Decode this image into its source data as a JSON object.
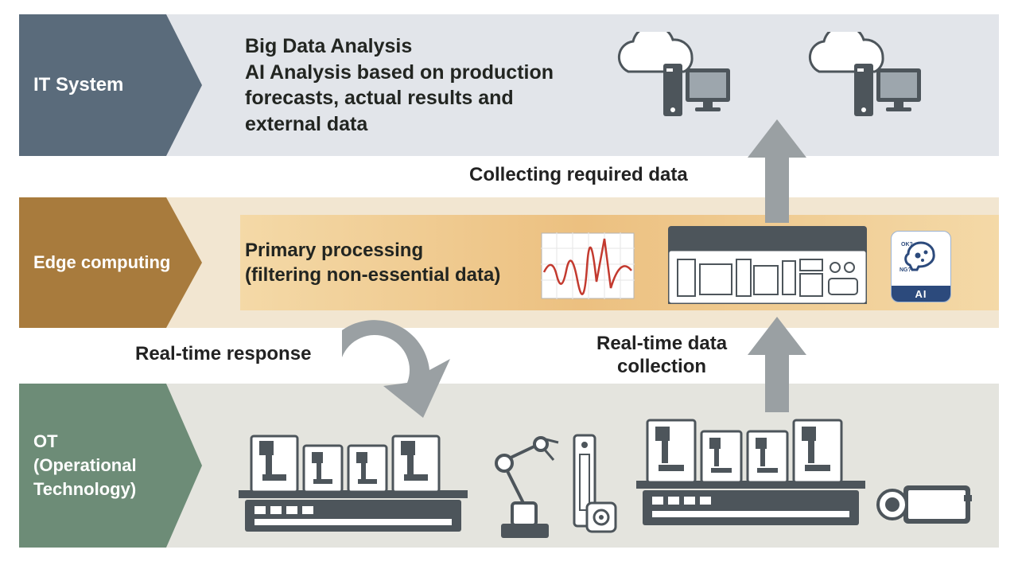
{
  "layers": {
    "it": {
      "title": "IT System",
      "text": "Big Data Analysis\nAI Analysis based on production forecasts, actual results and external data",
      "color": "#5a6b7b",
      "band_color": "#e2e5ea"
    },
    "edge": {
      "title": "Edge computing",
      "text": "Primary processing\n(filtering non-essential data)",
      "color": "#a87b3d",
      "band_color": "#f2e6d1"
    },
    "ot": {
      "title": "OT\n(Operational\nTechnology)",
      "color": "#6d8c77",
      "band_color": "#e4e4de"
    }
  },
  "flow_labels": {
    "collecting": "Collecting required data",
    "realtime_response": "Real-time response",
    "realtime_collection": "Real-time data\ncollection"
  },
  "ai_badge": {
    "ok": "OK?",
    "ng": "NG?",
    "label": "AI"
  },
  "icons": {
    "dark": "#4d555b",
    "light": "#fff",
    "stroke": "#3f4448",
    "red": "#c33a2f"
  }
}
